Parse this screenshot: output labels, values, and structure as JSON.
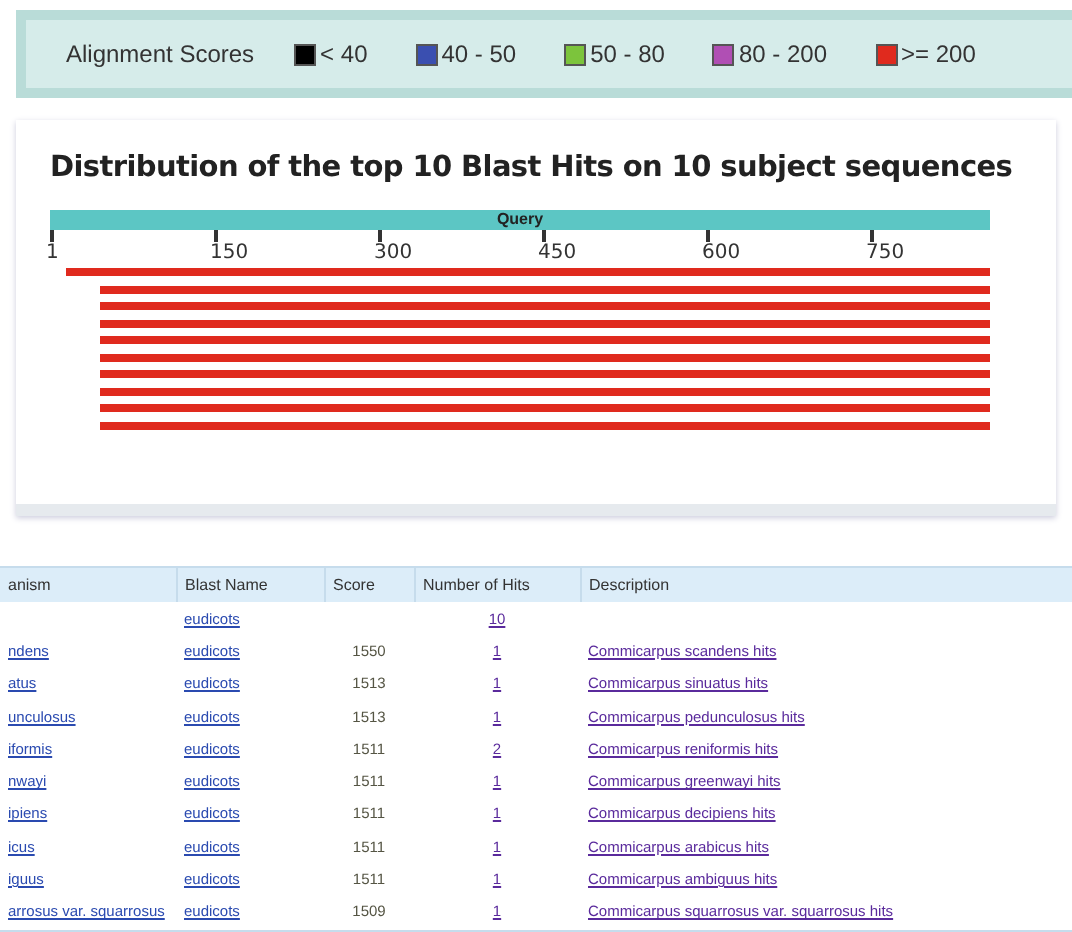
{
  "legend": {
    "title": "Alignment Scores",
    "items": [
      {
        "label": "< 40",
        "color": "#000000"
      },
      {
        "label": "40 - 50",
        "color": "#3a4fb0"
      },
      {
        "label": "50 - 80",
        "color": "#7cc43c"
      },
      {
        "label": "80 - 200",
        "color": "#b04fb4"
      },
      {
        "label": ">= 200",
        "color": "#e02a1e"
      }
    ]
  },
  "graphic": {
    "title": "Distribution of the top 10 Blast Hits on 10 subject sequences",
    "query_label": "Query",
    "ticks": [
      "1",
      "150",
      "300",
      "450",
      "600",
      "750"
    ],
    "hits": [
      {
        "kind": "full",
        "color": "#e02a1e"
      },
      {
        "kind": "offset",
        "color": "#e02a1e"
      },
      {
        "kind": "offset",
        "color": "#e02a1e"
      },
      {
        "kind": "offset",
        "color": "#e02a1e"
      },
      {
        "kind": "offset",
        "color": "#e02a1e"
      },
      {
        "kind": "offset",
        "color": "#e02a1e"
      },
      {
        "kind": "offset",
        "color": "#e02a1e"
      },
      {
        "kind": "offset",
        "color": "#e02a1e"
      },
      {
        "kind": "offset",
        "color": "#e02a1e"
      },
      {
        "kind": "offset",
        "color": "#e02a1e"
      }
    ]
  },
  "table": {
    "columns": [
      "anism",
      "Blast Name",
      "Score",
      "Number of Hits",
      "Description"
    ],
    "rows": [
      {
        "organism": "",
        "blast_name": "eudicots",
        "score": "",
        "hits": "10",
        "description": ""
      },
      {
        "organism": "ndens",
        "blast_name": "eudicots",
        "score": "1550",
        "hits": "1",
        "description": "Commicarpus scandens hits"
      },
      {
        "organism": "atus",
        "blast_name": "eudicots",
        "score": "1513",
        "hits": "1",
        "description": "Commicarpus sinuatus hits"
      },
      {
        "organism": "unculosus",
        "blast_name": "eudicots",
        "score": "1513",
        "hits": "1",
        "description": "Commicarpus pedunculosus hits"
      },
      {
        "organism": "iformis",
        "blast_name": "eudicots",
        "score": "1511",
        "hits": "2",
        "description": "Commicarpus reniformis hits"
      },
      {
        "organism": "nwayi",
        "blast_name": "eudicots",
        "score": "1511",
        "hits": "1",
        "description": "Commicarpus greenwayi hits"
      },
      {
        "organism": "ipiens",
        "blast_name": "eudicots",
        "score": "1511",
        "hits": "1",
        "description": "Commicarpus decipiens hits"
      },
      {
        "organism": "icus",
        "blast_name": "eudicots",
        "score": "1511",
        "hits": "1",
        "description": "Commicarpus arabicus hits"
      },
      {
        "organism": "iguus",
        "blast_name": "eudicots",
        "score": "1511",
        "hits": "1",
        "description": "Commicarpus ambiguus hits"
      },
      {
        "organism": "arrosus var. squarrosus",
        "blast_name": "eudicots",
        "score": "1509",
        "hits": "1",
        "description": "Commicarpus squarrosus var. squarrosus hits"
      }
    ]
  }
}
